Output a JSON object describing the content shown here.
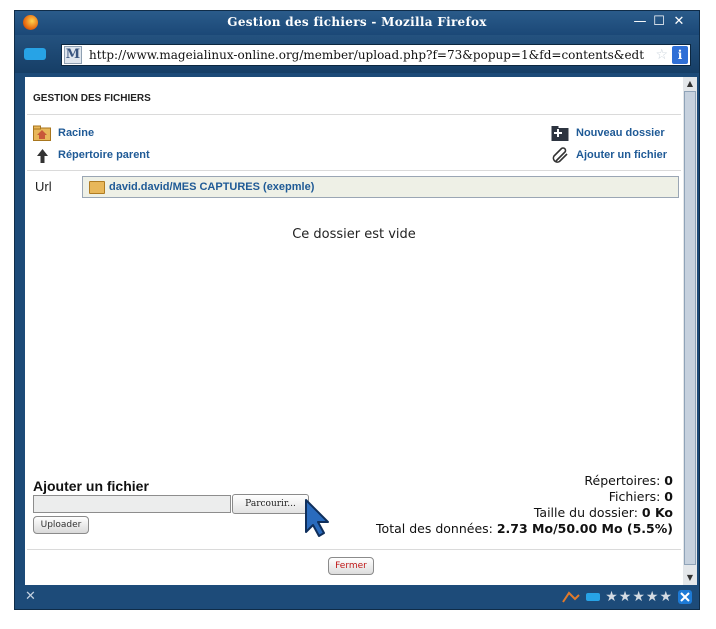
{
  "window": {
    "title": "Gestion des fichiers - Mozilla Firefox"
  },
  "address_bar": {
    "url": "http://www.mageialinux-online.org/member/upload.php?f=73&popup=1&fd=contents&edt"
  },
  "page": {
    "title": "GESTION DES FICHIERS",
    "links": {
      "root": "Racine",
      "parent": "Répertoire parent",
      "new_folder": "Nouveau dossier",
      "add_file": "Ajouter un fichier"
    },
    "url_label": "Url",
    "path": "david.david/MES CAPTURES (exepmle)",
    "empty_message": "Ce dossier est vide"
  },
  "upload": {
    "title": "Ajouter un fichier",
    "browse_label": "Parcourir...",
    "upload_label": "Uploader",
    "file_value": ""
  },
  "stats": {
    "dirs_label": "Répertoires:",
    "dirs_value": "0",
    "files_label": "Fichiers:",
    "files_value": "0",
    "size_label": "Taille du dossier:",
    "size_value": "0 Ko",
    "total_label": "Total des données:",
    "total_value": "2.73 Mo/50.00 Mo (5.5%)"
  },
  "footer": {
    "close_label": "Fermer"
  },
  "colors": {
    "window_frame": "#1c4a78",
    "link": "#1f5a96",
    "close_text": "#c01818"
  }
}
